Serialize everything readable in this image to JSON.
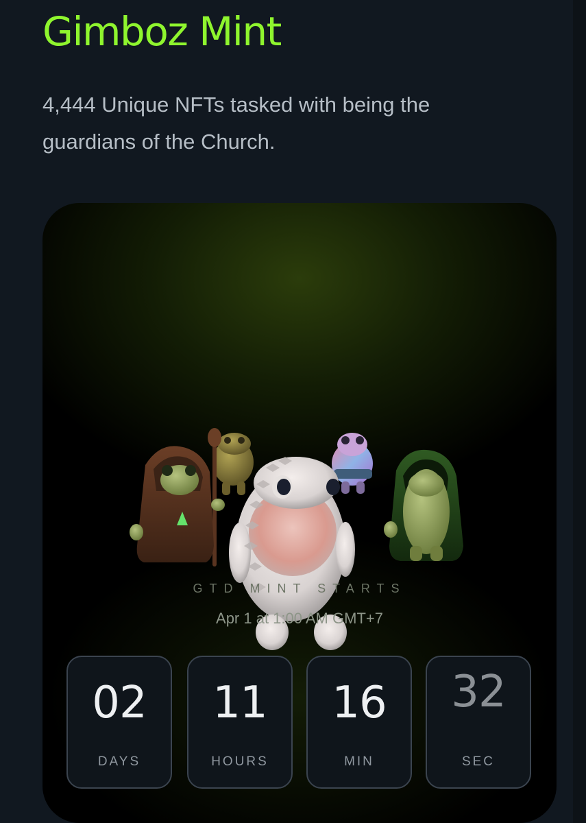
{
  "header": {
    "title": "Gimboz Mint",
    "subtitle": "4,444 Unique NFTs tasked with being the guardians of the Church."
  },
  "mint": {
    "label": "GTD MINT STARTS",
    "date": "Apr 1 at 1:00 AM GMT+7"
  },
  "countdown": [
    {
      "value": "02",
      "unit": "DAYS"
    },
    {
      "value": "11",
      "unit": "HOURS"
    },
    {
      "value": "16",
      "unit": "MIN"
    },
    {
      "value": "32",
      "unit": "SEC"
    }
  ],
  "colors": {
    "accent": "#8ff52e",
    "background": "#111820",
    "card": "#000000"
  }
}
